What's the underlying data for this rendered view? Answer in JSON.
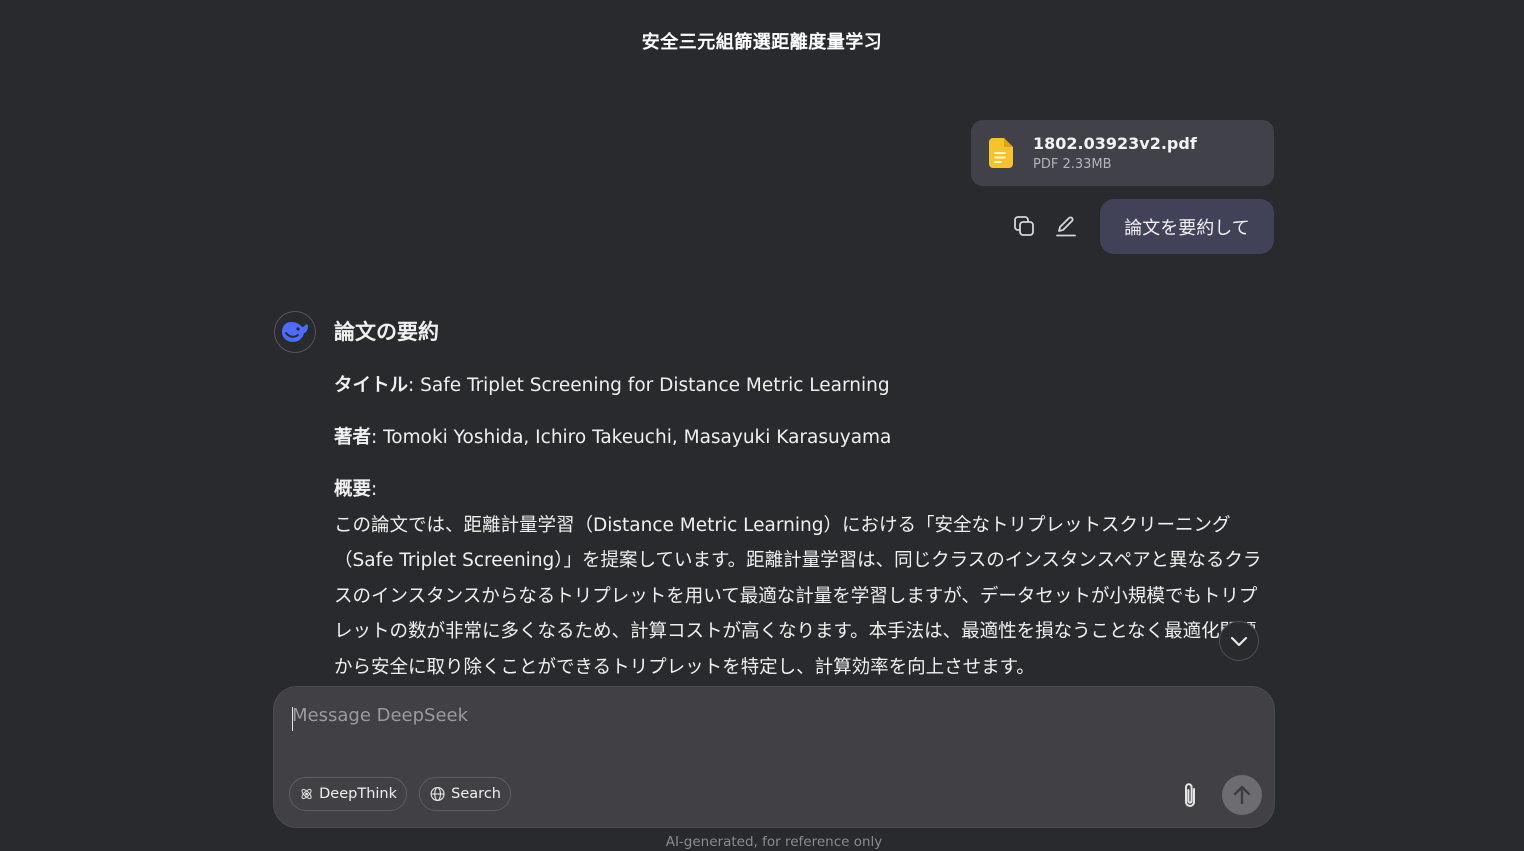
{
  "conversation": {
    "title": "安全三元組篩選距離度量学习"
  },
  "attachment": {
    "file_name": "1802.03923v2.pdf",
    "file_meta": "PDF 2.33MB"
  },
  "user_message": {
    "text": "論文を要約して"
  },
  "assistant": {
    "heading": "論文の要約",
    "title_label": "タイトル",
    "title_value": ": Safe Triplet Screening for Distance Metric Learning",
    "authors_label": "著者",
    "authors_value": ": Tomoki Yoshida, Ichiro Takeuchi, Masayuki Karasuyama",
    "abstract_label": "概要",
    "abstract_colon": ":",
    "abstract_text": "この論文では、距離計量学習（Distance Metric Learning）における「安全なトリプレットスクリーニング（Safe Triplet Screening）」を提案しています。距離計量学習は、同じクラスのインスタンスペアと異なるクラスのインスタンスからなるトリプレットを用いて最適な計量を学習しますが、データセットが小規模でもトリプレットの数が非常に多くなるため、計算コストが高くなります。本手法は、最適性を損なうことなく最適化問題から安全に取り除くことができるトリプレットを特定し、計算効率を向上させます。"
  },
  "composer": {
    "placeholder": "Message DeepSeek",
    "value": "",
    "deepthink_label": "DeepThink",
    "search_label": "Search"
  },
  "footer": {
    "note": "AI-generated, for reference only"
  },
  "icons": {
    "file": "document-icon",
    "copy": "copy-icon",
    "edit": "pencil-icon",
    "avatar": "deepseek-whale-icon",
    "scroll": "chevron-down-icon",
    "deepthink": "atom-icon",
    "search": "globe-icon",
    "attach": "paperclip-icon",
    "send": "arrow-up-icon"
  },
  "colors": {
    "background": "#292a2d",
    "bubble": "#414158",
    "file_icon": "#f7c32b",
    "avatar_blue": "#4d6bfe"
  }
}
